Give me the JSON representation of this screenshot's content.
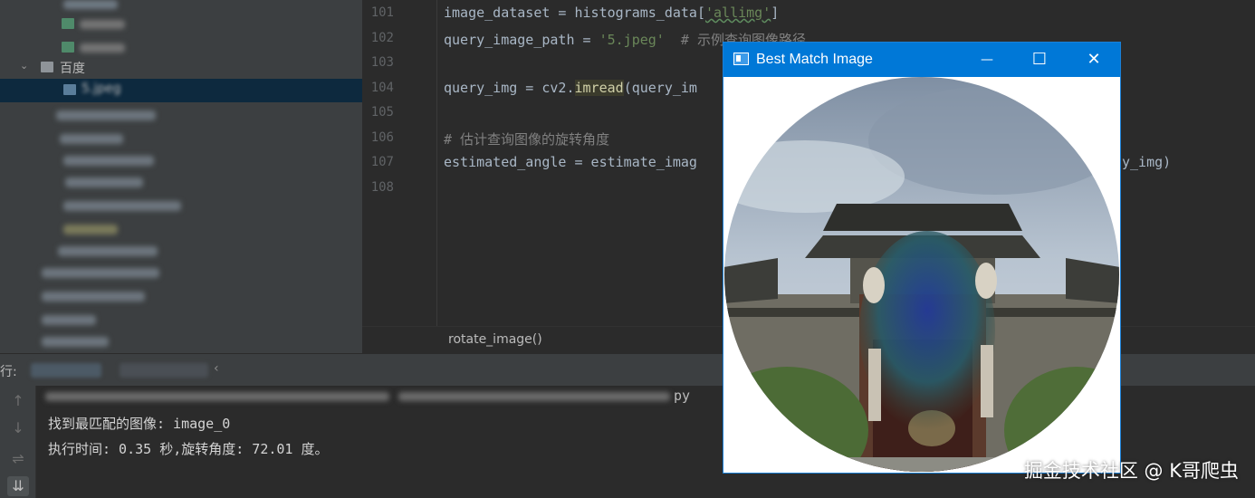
{
  "tree": {
    "rows": [
      {
        "label": "百度",
        "kind": "folder"
      },
      {
        "label": "5.jpeg",
        "kind": "image"
      }
    ]
  },
  "editor": {
    "line_numbers": [
      "101",
      "102",
      "103",
      "104",
      "105",
      "106",
      "107",
      "108"
    ],
    "lines": {
      "l101": {
        "a": "image_dataset = histograms_data[",
        "b": "'allimg'",
        "c": "]"
      },
      "l102": {
        "a": "query_image_path = ",
        "b": "'5.jpeg'",
        "c": "  # 示例查询图像路径"
      },
      "l104": {
        "a": "query_img = cv2.",
        "b": "imread",
        "c": "(query_im"
      },
      "l106": {
        "a": "# 估计查询图像的旋转角度"
      },
      "l107": {
        "a": "estimated_angle = estimate_imag",
        "b": "y_img)"
      }
    }
  },
  "breadcrumb": "rotate_image()",
  "run": {
    "label": "行:",
    "output": [
      "找到最匹配的图像: image_0",
      "执行时间: 0.35 秒,旋转角度: 72.01 度。"
    ],
    "partial_line_suffix": "py"
  },
  "window": {
    "title": "Best Match Image",
    "minimize_label": "—",
    "maximize_label": "☐",
    "close_label": "✕"
  },
  "watermark": "掘金技术社区 @ K哥爬虫"
}
